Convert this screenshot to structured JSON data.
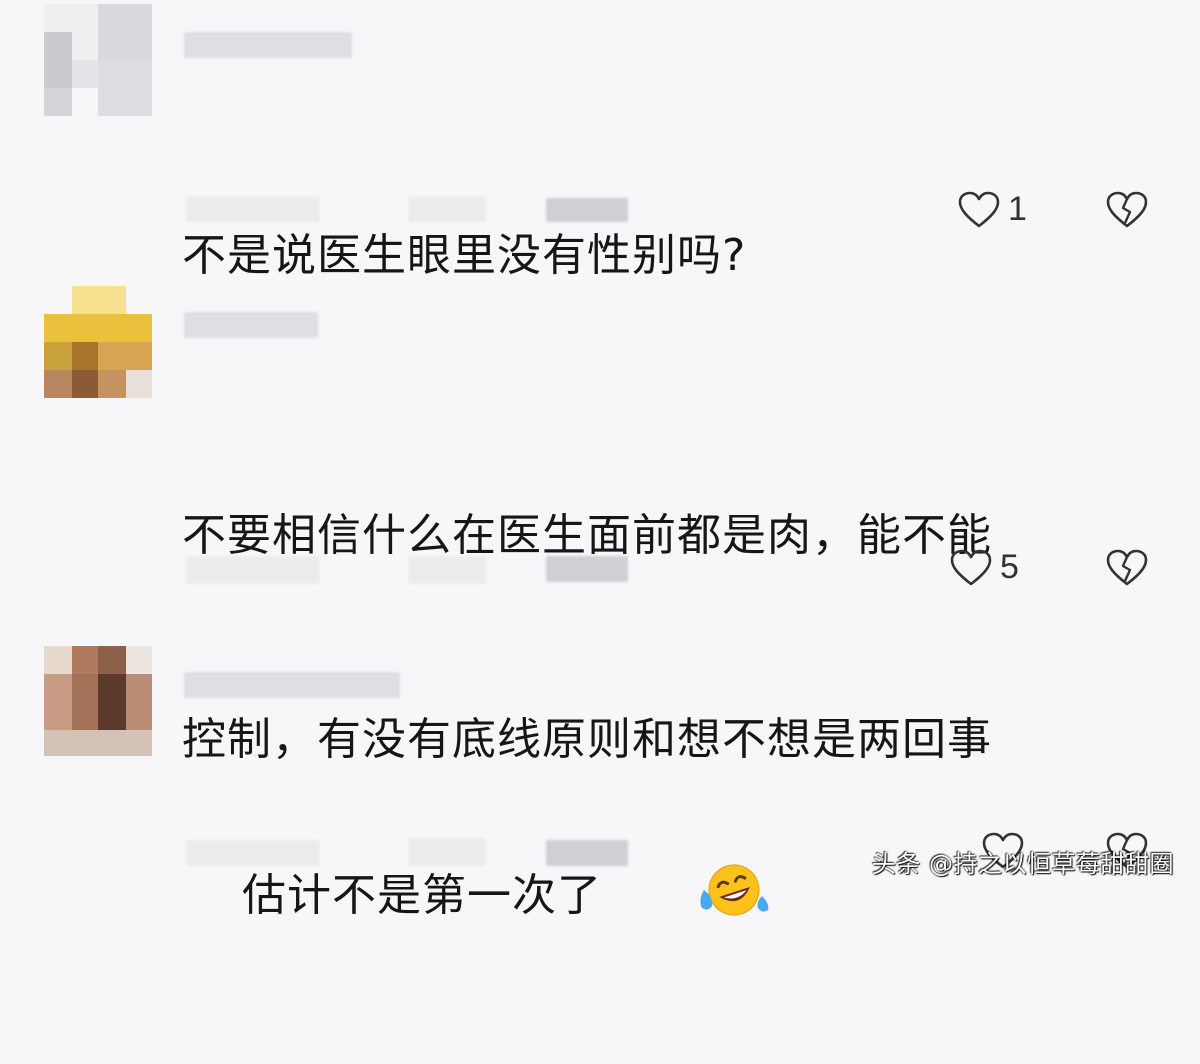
{
  "comments": [
    {
      "text_lines": [
        "不是说医生眼里没有性别吗?"
      ],
      "likes": "1"
    },
    {
      "text_lines": [
        "不要相信什么在医生面前都是肉，能不能",
        "控制，有没有底线原则和想不想是两回事"
      ],
      "likes": "5"
    },
    {
      "text_lines": [
        "估计不是第一次了"
      ],
      "likes": ""
    }
  ],
  "icons": {
    "like": "heart-outline-icon",
    "dislike": "broken-heart-icon",
    "emoji": "rofl-emoji-icon"
  },
  "watermark": "头条 @持之以恒草莓甜甜圈",
  "colors": {
    "background": "#f7f7fa",
    "text": "#161616",
    "icon": "#333333"
  }
}
